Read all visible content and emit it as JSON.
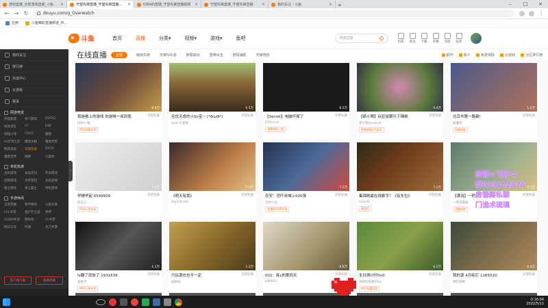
{
  "browser": {
    "tabs": [
      {
        "title": "游戏直播_全部游戏直播_斗鱼直播",
        "active": false
      },
      {
        "title": "守望先锋直播_守望先锋直播视频",
        "active": true
      },
      {
        "title": "KINA的直播_守望先锋直播视频",
        "active": false
      },
      {
        "title": "守望先锋直播_守望先锋直播",
        "active": false
      },
      {
        "title": "我的关注 - 斗鱼",
        "active": false
      }
    ],
    "url": "douyu.com/g_Overwatch",
    "bookmarks": [
      "应用",
      "斗鱼精彩直播频道_中..."
    ]
  },
  "header": {
    "logo_text": "斗鱼",
    "nav": [
      "首页",
      "直播",
      "分类▾",
      "视频▾",
      "游戏▾",
      "鱼吧"
    ],
    "active_nav": 1,
    "search_placeholder": "搜索直播",
    "icons": [
      {
        "label": "历史",
        "icon": "history-icon"
      },
      {
        "label": "关注",
        "icon": "follow-icon"
      },
      {
        "label": "下载",
        "icon": "download-icon"
      },
      {
        "label": "开播",
        "icon": "live-icon"
      },
      {
        "label": "消息",
        "icon": "message-icon"
      },
      {
        "label": "任务",
        "icon": "task-icon"
      }
    ]
  },
  "sidebar": {
    "top_items": [
      "我的关注",
      "排行榜",
      "充值中心",
      "云游戏",
      "赛事"
    ],
    "sections": [
      {
        "title": "网游竞技",
        "items": [
          "英雄联盟",
          "热门游戏",
          "DOTA2",
          "绝地求生",
          "CF",
          "DNF",
          "穿越火线",
          "CSGO",
          "魔兽",
          "lol云顶之弈",
          "魔兽争霸",
          "魔兽世界",
          "网游竞技",
          "守望先锋",
          "DOTA",
          "魔兽世界",
          "棋牌",
          "三国杀"
        ],
        "active": "守望先锋"
      },
      {
        "title": "单机热游",
        "items": [
          "主机游戏",
          "永劫无间",
          "怀旧游戏",
          "恐怖游戏",
          "文字冒险",
          "主机游戏",
          "独立游戏",
          "海上霸主",
          "单机游戏"
        ]
      },
      {
        "title": "手游休闲",
        "items": [
          "王者荣耀",
          "和平精英",
          "火影忍者",
          "LOL手游",
          "金铲铲之战",
          "原神",
          "CODM手游",
          "阴阳师",
          "CF手游",
          "明日方舟",
          "鸣潮",
          "天刀手游"
        ]
      }
    ],
    "buttons": [
      "客户端下载",
      "我要开播"
    ]
  },
  "main": {
    "title": "在线直播",
    "all_label": "全部",
    "filters": [
      "萌妹先锋",
      "天梯500强",
      "随意输出",
      "重拳出击",
      "剧情辅助",
      "天梯竞技"
    ],
    "right_links": [
      "颜升",
      "新人",
      "免费领取",
      "云游戏",
      "分区排行榜"
    ]
  },
  "cards": [
    {
      "title": "我是看上的游戏 你是唯一阅到我",
      "category": "守望先锋",
      "streamer": "RNA小猴",
      "views": "8.8万",
      "tag": "PRO邪魔坦克"
    },
    {
      "title": "无忧无虑的小So宝~ (*ФωФ*)",
      "category": "守望先锋",
      "streamer": "Solar小猫咪",
      "views": "6.5万",
      "tag": ""
    },
    {
      "title": "【Secret】电脑坏掉了",
      "category": "守望先锋",
      "streamer": "U2Secret",
      "views": "8.5万",
      "tag": "直播领取一键"
    },
    {
      "title": "【昂小莺】玩狂鼠跟乐下辣椒",
      "category": "守望先锋",
      "streamer": "昂小莺Deutsutl",
      "views": "4.4万",
      "tag": "直播领取1个风花"
    },
    {
      "title": "北京市第一路霸!",
      "category": "守望先锋",
      "streamer": "猛禽吧",
      "views": "1.5万",
      "tag": "直播领取"
    },
    {
      "title": "早睡早起 6599909",
      "category": "守望先锋",
      "streamer": "阿五三",
      "views": "7.2万",
      "tag": "PRO行星成员"
    },
    {
      "title": "《明天有我》",
      "category": "守望先锋",
      "streamer": "Big5d4198",
      "views": "7.2万",
      "tag": ""
    },
    {
      "title": "忠安：恐吓米喊上500强",
      "category": "守望先锋",
      "streamer": "云村小龙",
      "views": "7.2万",
      "tag": "直播间CARRY男"
    },
    {
      "title": "集锦刷最在线数字？《有车位》",
      "category": "守望先锋",
      "streamer": "GG&Xk",
      "views": "7.1万",
      "tag": "聊游戏"
    },
    {
      "title": "【满羽】一把寻、五百强",
      "category": "守望先锋",
      "streamer": "一梦成嘉妞",
      "views": "1.5万",
      "tag": "直播领取"
    },
    {
      "title": "fz翻了就放了 1931638",
      "category": "守望先锋",
      "streamer": "益紫子",
      "views": "1.1万",
      "tag": "PRO行星成员"
    },
    {
      "title": "只玩源也也不一定",
      "category": "守望先锋",
      "streamer": "益紫妹",
      "views": "1.2万",
      "tag": ""
    },
    {
      "title": "002：练c的第四天",
      "category": "守望先锋",
      "streamer": "b88862",
      "views": "8.8万",
      "tag": ""
    },
    {
      "title": "生日倒计时0v0",
      "category": "守望先锋",
      "streamer": "林阳的炼钢子tie",
      "views": "6.2万",
      "tag": "PRO邪魔坦克"
    },
    {
      "title": "我的源 4月练打 1265020",
      "category": "守望先锋",
      "streamer": "林花落喔",
      "views": "6.4万",
      "tag": ""
    }
  ],
  "overlay_text": [
    "房管=飞机*2",
    "群835162676",
    "房管群私聊",
    "门诡术琉璃"
  ],
  "clock": {
    "time": "0:16:04",
    "date": "2022/5/11"
  },
  "colors": {
    "accent": "#ff7700",
    "sidebar_bg": "#2b2b2b",
    "overlay": "#c08aff"
  }
}
